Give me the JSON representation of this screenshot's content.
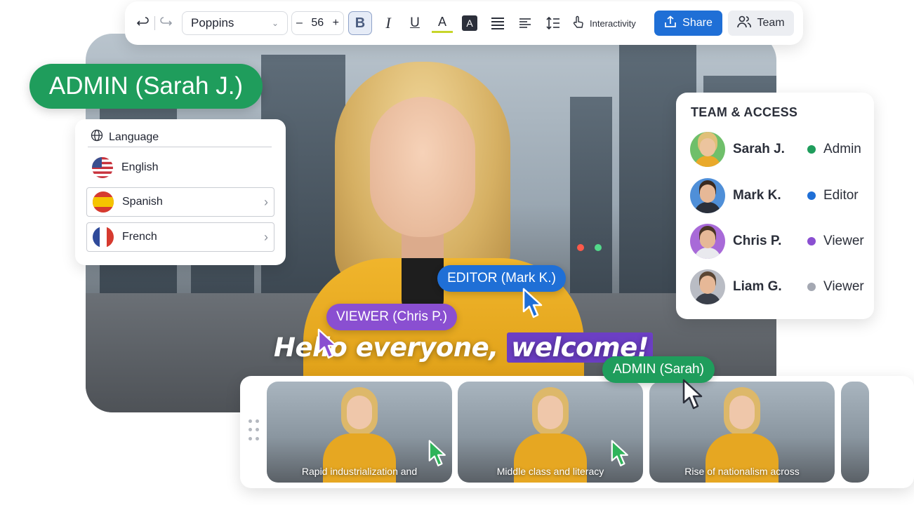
{
  "toolbar": {
    "font": "Poppins",
    "font_size": "56",
    "bold_label": "B",
    "italic_label": "I",
    "underline_label": "U",
    "color_label": "A",
    "highlight_label": "A",
    "interactivity_label": "Interactivity",
    "share_label": "Share",
    "team_label": "Team",
    "icons": [
      "undo-icon",
      "redo-icon",
      "chevron-down-icon",
      "minus-icon",
      "plus-icon",
      "align-justify-icon",
      "align-left-icon",
      "line-spacing-icon",
      "pointer-hand-icon",
      "share-upload-icon",
      "users-icon"
    ]
  },
  "admin_badge": "ADMIN (Sarah J.)",
  "language": {
    "heading": "Language",
    "items": [
      {
        "label": "English",
        "flag": "us"
      },
      {
        "label": "Spanish",
        "flag": "es"
      },
      {
        "label": "French",
        "flag": "fr"
      }
    ]
  },
  "team_panel": {
    "title": "TEAM & ACCESS",
    "members": [
      {
        "name": "Sarah J.",
        "role": "Admin",
        "color": "#1f9d5c"
      },
      {
        "name": "Mark K.",
        "role": "Editor",
        "color": "#1f6fd6"
      },
      {
        "name": "Chris P.",
        "role": "Viewer",
        "color": "#8a4fd1"
      },
      {
        "name": "Liam G.",
        "role": "Viewer",
        "color": "#a4a8b2"
      }
    ]
  },
  "caption": {
    "part1": "Hello everyone, ",
    "highlight": "welcome!"
  },
  "cursor_tags": {
    "editor": "EDITOR (Mark K.)",
    "viewer": "VIEWER (Chris P.)",
    "admin": "ADMIN (Sarah)"
  },
  "filmstrip": {
    "thumbs": [
      {
        "caption": "Rapid industrialization and"
      },
      {
        "caption": "Middle class and literacy"
      },
      {
        "caption": "Rise of nationalism across"
      }
    ]
  },
  "colors": {
    "admin": "#1f9d5c",
    "editor": "#1f6fd6",
    "viewer": "#8a4fd1",
    "share_button": "#1f6fd6"
  }
}
